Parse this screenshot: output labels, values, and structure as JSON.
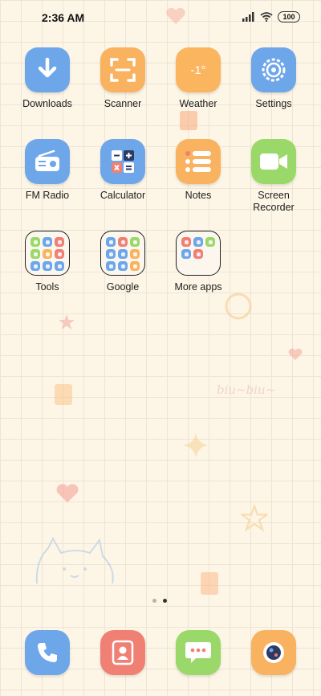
{
  "status_bar": {
    "time": "2:36 AM",
    "battery": "100",
    "icons": [
      "signal-icon",
      "wifi-icon",
      "battery-icon"
    ]
  },
  "apps": [
    {
      "label": "Downloads",
      "color": "#6ea6ea",
      "icon": "download-arrow-icon"
    },
    {
      "label": "Scanner",
      "color": "#f9b25f",
      "icon": "scan-frame-icon"
    },
    {
      "label": "Weather",
      "color": "#fbb55f",
      "icon": "weather-icon",
      "temp": "-1°"
    },
    {
      "label": "Settings",
      "color": "#6ea6ea",
      "icon": "gear-icon"
    },
    {
      "label": "FM Radio",
      "color": "#6ea6ea",
      "icon": "radio-icon"
    },
    {
      "label": "Calculator",
      "color": "#6ea6ea",
      "icon": "calculator-icon"
    },
    {
      "label": "Notes",
      "color": "#f9b25f",
      "icon": "notes-list-icon"
    },
    {
      "label": "Screen Recorder",
      "color": "#9bd86a",
      "icon": "video-camera-icon"
    }
  ],
  "folders": [
    {
      "label": "Tools",
      "mini_colors": [
        "#9bd86a",
        "#6ea6ea",
        "#f07f74",
        "#9bd86a",
        "#f9b25f",
        "#f07f74",
        "#6ea6ea",
        "#6ea6ea",
        "#6ea6ea"
      ]
    },
    {
      "label": "Google",
      "mini_colors": [
        "#6ea6ea",
        "#f07f74",
        "#9bd86a",
        "#6ea6ea",
        "#6ea6ea",
        "#f9b25f",
        "#6ea6ea",
        "#6ea6ea",
        "#f9b25f"
      ]
    },
    {
      "label": "More apps",
      "mini_colors": [
        "#f07f74",
        "#6ea6ea",
        "#9bd86a",
        "#6ea6ea",
        "#f07f74"
      ]
    }
  ],
  "page_indicator": {
    "pages": 2,
    "active": 2
  },
  "dock": [
    {
      "name": "phone",
      "color": "#6ea6ea",
      "icon": "phone-icon"
    },
    {
      "name": "contacts",
      "color": "#f07f74",
      "icon": "contacts-icon"
    },
    {
      "name": "messages",
      "color": "#9bd86a",
      "icon": "message-bubble-icon"
    },
    {
      "name": "camera",
      "color": "#f9b25f",
      "icon": "camera-lens-icon"
    }
  ],
  "wallpaper": {
    "text": "biu~biu~"
  }
}
